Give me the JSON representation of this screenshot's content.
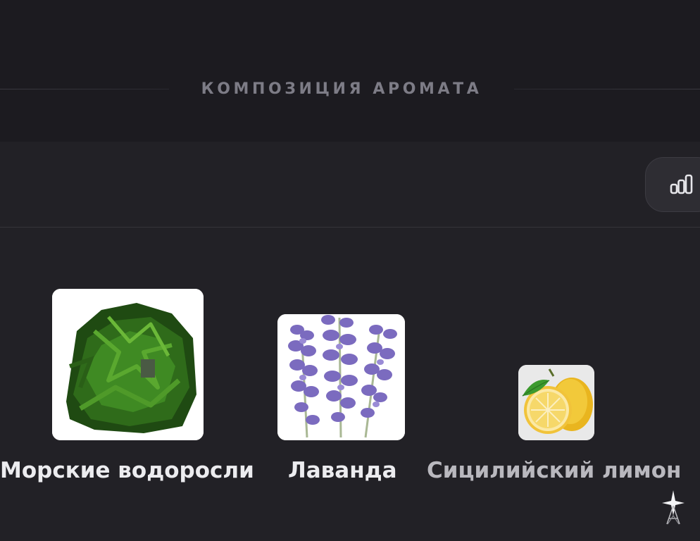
{
  "section": {
    "title": "КОМПОЗИЦИЯ АРОМАТА"
  },
  "toolbar": {
    "stats_icon": "bar-chart-icon"
  },
  "notes": [
    {
      "label": "Морские водоросли",
      "image": "seaweed-image"
    },
    {
      "label": "Лаванда",
      "image": "lavender-image"
    },
    {
      "label": "Сицилийский лимон",
      "image": "lemon-image"
    }
  ],
  "colors": {
    "background": "#222126",
    "top_band": "#1c1b20",
    "title_text": "#7d7c86",
    "label_text": "#ececef",
    "label_faded": "#b9b8be"
  }
}
